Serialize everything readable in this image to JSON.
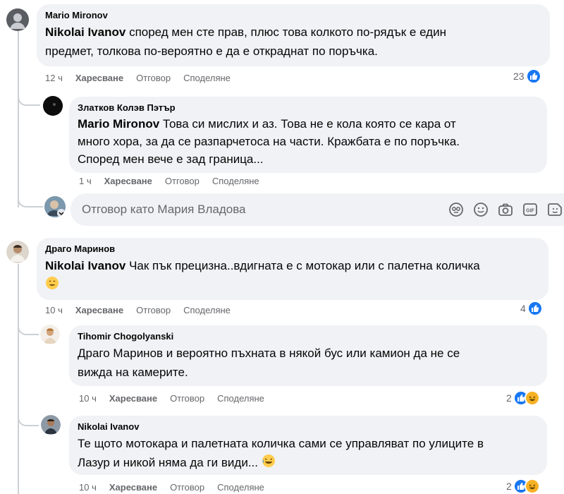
{
  "comments": [
    {
      "author": "Mario Mironov",
      "mention": "Nikolai Ivanov",
      "line1": "според мен сте прав, плюс това колкото по-рядък е един",
      "line2": "предмет, толкова по-вероятно е да е откраднат по поръчка.",
      "time": "12 ч",
      "like": "Харесване",
      "reply": "Отговор",
      "share": "Споделяне",
      "reactions": "23"
    },
    {
      "author": "Златков Колэв Пэтър",
      "mention": "Mario Mironov",
      "line1": "Това си мислих и аз. Това не е кола която се кара от",
      "line2": "много хора, за да се разпарчетоса на части. Кражбата е по поръчка.",
      "line3": "Според мен вече е зад граница...",
      "time": "1 ч",
      "like": "Харесване",
      "reply": "Отговор",
      "share": "Споделяне"
    },
    {
      "author": "Драго Маринов",
      "mention": "Nikolai Ivanov",
      "line1": "Чак пък прецизна..вдигната е с мотокар или с палетна количка",
      "time": "10 ч",
      "like": "Харесване",
      "reply": "Отговор",
      "share": "Споделяне",
      "reactions": "4"
    },
    {
      "author": "Tihomir Chogolyanski",
      "line1": "Драго Маринов и вероятно пъхната в някой бус или камион да не се",
      "line2": "вижда на камерите.",
      "time": "10 ч",
      "like": "Харесване",
      "reply": "Отговор",
      "share": "Споделяне",
      "reactions": "2"
    },
    {
      "author": "Nikolai Ivanov",
      "line1": "Те щото мотокара и палетната количка сами се управляват по улиците в",
      "line2": "Лазур и никой няма да ги види...",
      "time": "10 ч",
      "like": "Харесване",
      "reply": "Отговор",
      "share": "Споделяне",
      "reactions": "2"
    }
  ],
  "reply_box": {
    "placeholder": "Отговор като Мария Владова",
    "icons": [
      "avatar-sticker-icon",
      "emoji-icon",
      "camera-icon",
      "gif-icon",
      "sticker-icon"
    ]
  },
  "colors": {
    "bubble": "#f0f2f5",
    "meta": "#65676b",
    "like": "#1877f2",
    "thread": "#ccd0d5"
  }
}
